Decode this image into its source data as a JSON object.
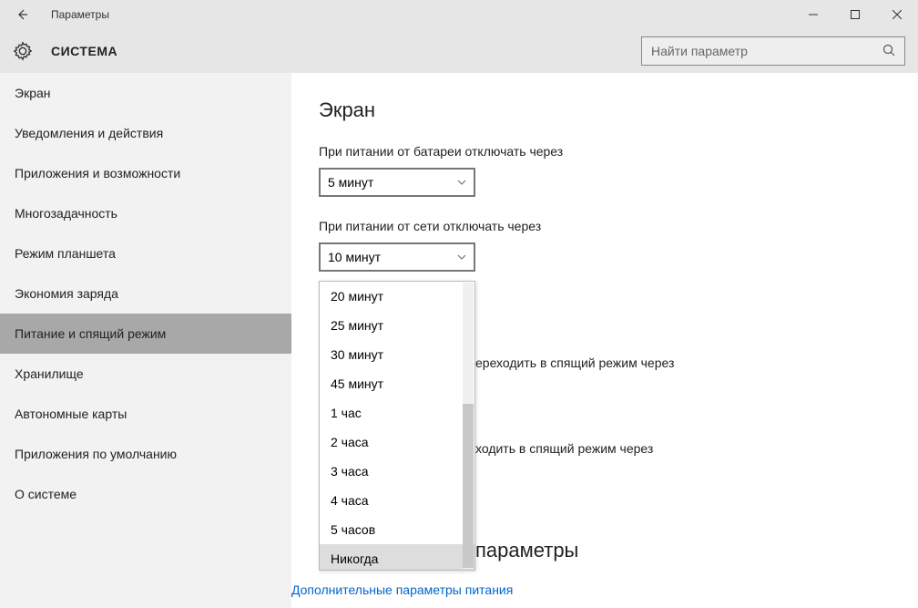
{
  "titlebar": {
    "title": "Параметры"
  },
  "header": {
    "title": "СИСТЕМА",
    "search_placeholder": "Найти параметр"
  },
  "sidebar": {
    "items": [
      {
        "label": "Экран"
      },
      {
        "label": "Уведомления и действия"
      },
      {
        "label": "Приложения и возможности"
      },
      {
        "label": "Многозадачность"
      },
      {
        "label": "Режим планшета"
      },
      {
        "label": "Экономия заряда"
      },
      {
        "label": "Питание и спящий режим"
      },
      {
        "label": "Хранилище"
      },
      {
        "label": "Автономные карты"
      },
      {
        "label": "Приложения по умолчанию"
      },
      {
        "label": "О системе"
      }
    ],
    "selected_index": 6
  },
  "main": {
    "heading": "Экран",
    "battery_label": "При питании от батареи отключать через",
    "battery_value": "5 минут",
    "plugged_label": "При питании от сети отключать через",
    "plugged_value": "10 минут",
    "sleep_battery_partial": "ереходить в спящий режим через",
    "sleep_plugged_partial": "ходить в спящий режим через",
    "related_heading_partial": "параметры",
    "related_link": "Дополнительные параметры питания"
  },
  "dropdown_options": [
    "20 минут",
    "25 минут",
    "30 минут",
    "45 минут",
    "1 час",
    "2 часа",
    "3 часа",
    "4 часа",
    "5 часов",
    "Никогда"
  ],
  "highlighted_option_index": 9
}
